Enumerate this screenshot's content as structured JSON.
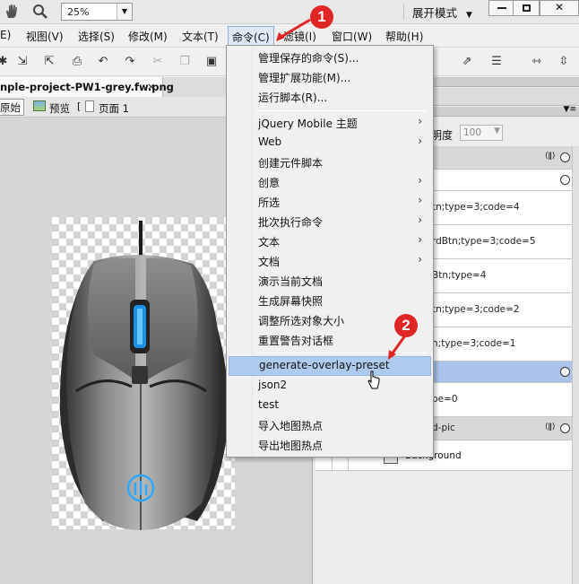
{
  "toolbar_top": {
    "zoom_value": "25%",
    "workspace_mode": "展开模式"
  },
  "menubar": {
    "items": [
      "E)",
      "视图(V)",
      "选择(S)",
      "修改(M)",
      "文本(T)",
      "命令(C)",
      "滤镜(I)",
      "窗口(W)",
      "帮助(H)"
    ]
  },
  "document": {
    "tab_name": "nple-project-PW1-grey.fw.png",
    "tab_close": "×",
    "view_original": "原始",
    "view_preview": "预览",
    "page_label": "页面 1"
  },
  "command_menu": {
    "items": [
      {
        "label": "管理保存的命令(S)...",
        "submenu": false
      },
      {
        "label": "管理扩展功能(M)...",
        "submenu": false
      },
      {
        "label": "运行脚本(R)...",
        "submenu": false
      },
      {
        "label": "jQuery Mobile 主题",
        "submenu": true
      },
      {
        "label": "Web",
        "submenu": true
      },
      {
        "label": "创建元件脚本",
        "submenu": false
      },
      {
        "label": "创意",
        "submenu": true
      },
      {
        "label": "所选",
        "submenu": true
      },
      {
        "label": "批次执行命令",
        "submenu": true
      },
      {
        "label": "文本",
        "submenu": true
      },
      {
        "label": "文档",
        "submenu": true
      },
      {
        "label": "演示当前文档",
        "submenu": false
      },
      {
        "label": "生成屏幕快照",
        "submenu": false
      },
      {
        "label": "调整所选对象大小",
        "submenu": false
      },
      {
        "label": "重置警告对话框",
        "submenu": false
      },
      {
        "label": "generate-overlay-preset",
        "submenu": false,
        "highlighted": true
      },
      {
        "label": "json2",
        "submenu": false
      },
      {
        "label": "test",
        "submenu": false
      },
      {
        "label": "导入地图热点",
        "submenu": false
      },
      {
        "label": "导出地图热点",
        "submenu": false
      }
    ],
    "submenu_arrow": "›"
  },
  "right_panel": {
    "opacity_label": "明度",
    "opacity_value": "100",
    "layers": [
      {
        "text": "",
        "selected": false
      },
      {
        "text": "",
        "selected": false
      },
      {
        "text": "tn;type=3;code=4",
        "selected": false
      },
      {
        "text": "rdBtn;type=3;code=5",
        "selected": false
      },
      {
        "text": "Btn;type=4",
        "selected": false
      },
      {
        "text": "tn;type=3;code=2",
        "selected": false
      },
      {
        "text": "n;type=3;code=1",
        "selected": false
      },
      {
        "text": "",
        "selected": true
      },
      {
        "text": "pe=0",
        "selected": false
      },
      {
        "text": "d-pic",
        "selected": false
      }
    ],
    "background_layer": "Background"
  },
  "annotations": {
    "badge1": "1",
    "badge2": "2"
  },
  "colors": {
    "menu_highlight": "#aecbee",
    "badge": "#e02525",
    "selected_layer": "#a9c2ea"
  }
}
